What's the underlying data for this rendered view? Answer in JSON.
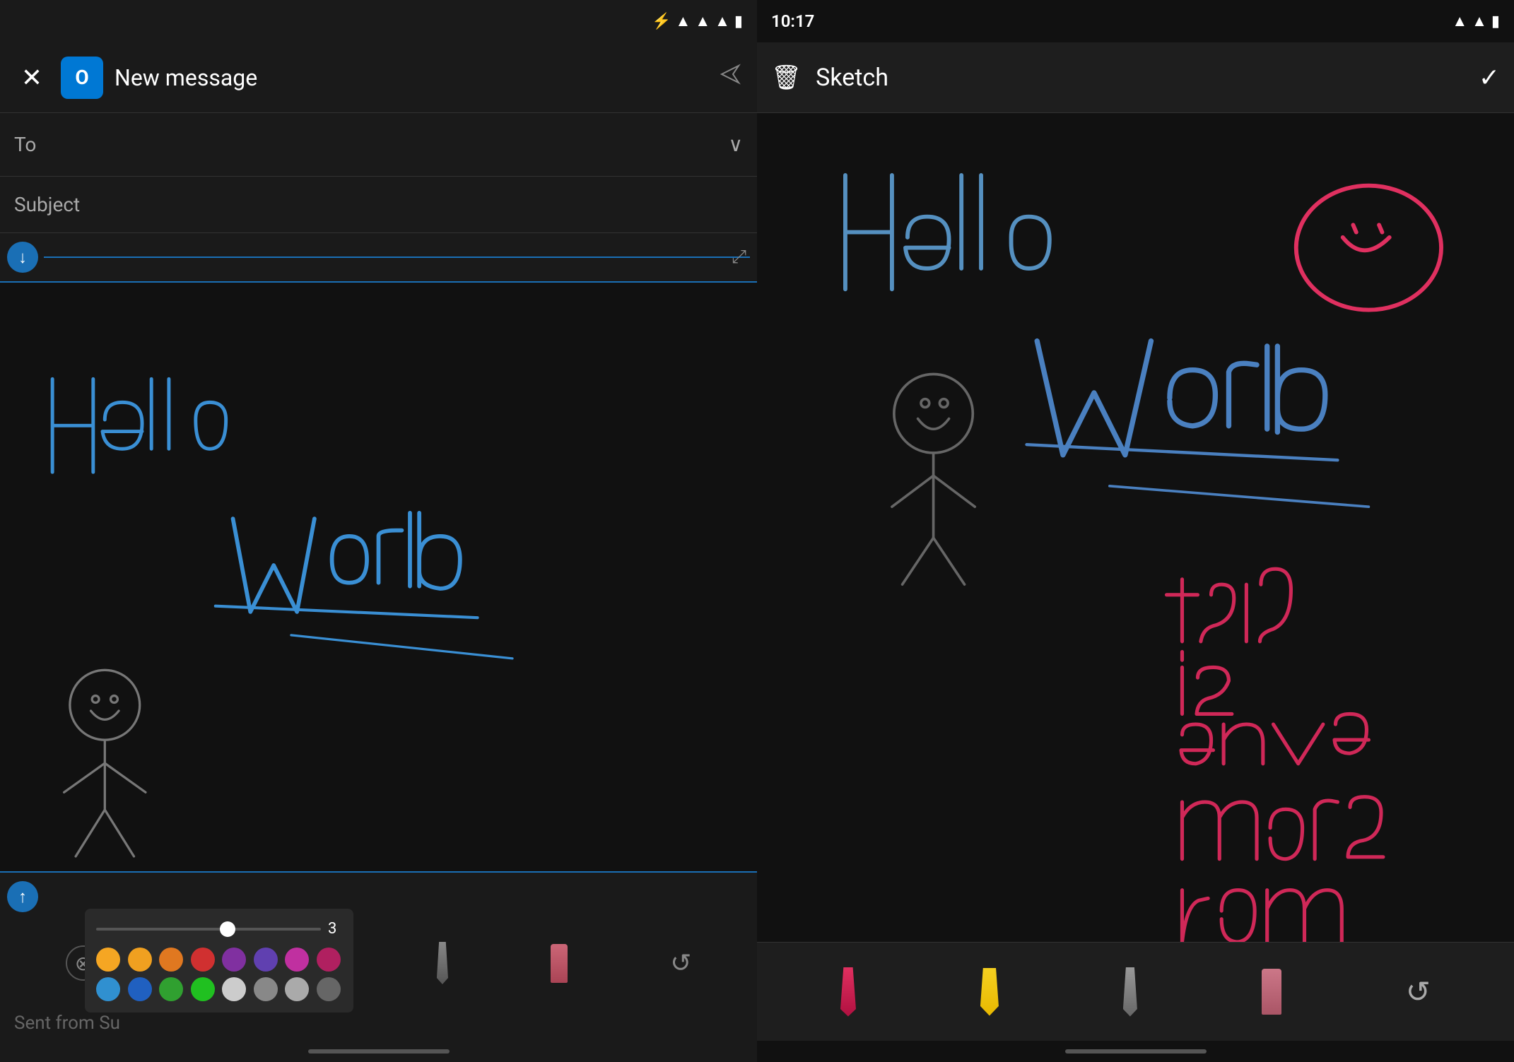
{
  "left": {
    "status": {
      "bluetooth": "⚡",
      "wifi": "▲",
      "signal": "▲",
      "battery": "🔋"
    },
    "header": {
      "close_label": "×",
      "app_icon": "O",
      "title": "New message",
      "send_icon": "▷"
    },
    "to_label": "To",
    "subject_label": "Subject",
    "toolbar": {
      "down_arrow": "↓",
      "expand_icon": "⤢"
    },
    "color_picker": {
      "slider_value": "3",
      "colors_row1": [
        "#f5a623",
        "#f0a020",
        "#e07820",
        "#d03030",
        "#8030a0",
        "#6040b0",
        "#c030a0",
        "#b02060"
      ],
      "colors_row2": [
        "#3090d0",
        "#2060c0",
        "#30a030",
        "#20c020",
        "#cccccc",
        "#888888",
        "#aaaaaa",
        "#888888"
      ]
    },
    "tools": {
      "clear_icon": "⊗",
      "undo_icon": "↺"
    },
    "sent_from": "Sent from Su",
    "bottom_bar": "home"
  },
  "right": {
    "status": {
      "time": "10:17",
      "wifi": "▲",
      "signal": "▲",
      "battery": "🔋"
    },
    "header": {
      "trash_icon": "🗑",
      "title": "Sketch",
      "check_icon": "✓"
    },
    "sketch_text": {
      "hello": "Hello",
      "world": "World",
      "body": "this is\neven more\nroom"
    }
  }
}
